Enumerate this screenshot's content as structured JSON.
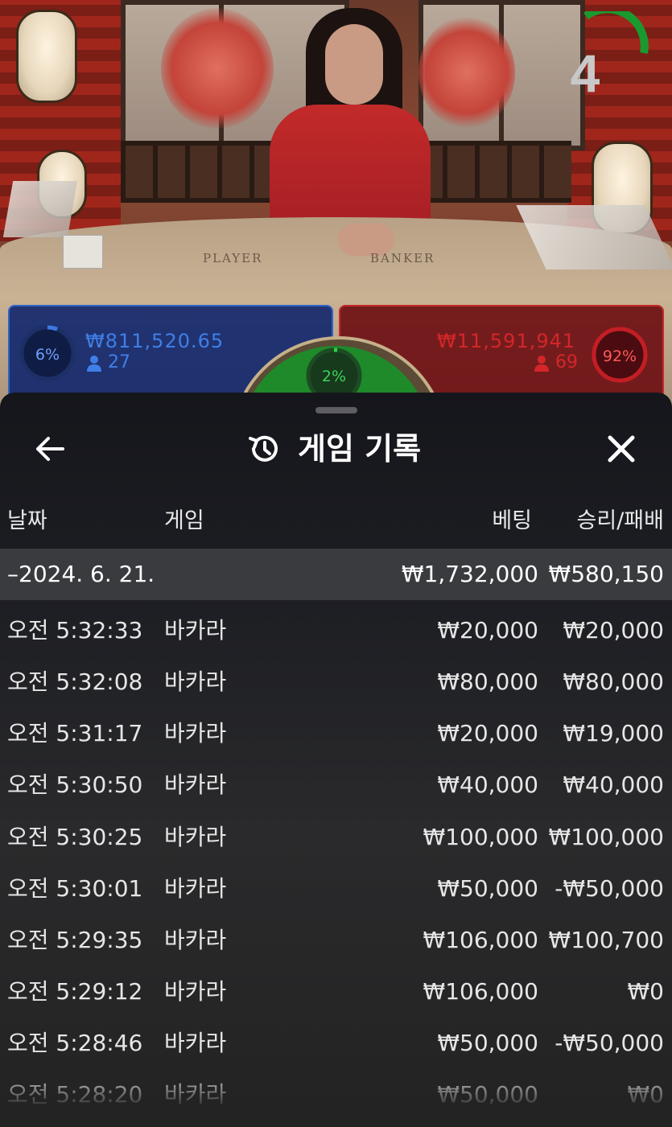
{
  "video": {
    "countdown": "4",
    "table_labels": {
      "player": "PLAYER",
      "banker": "BANKER"
    }
  },
  "betting": {
    "player": {
      "percent": "6%",
      "amount": "₩811,520.65",
      "count": "27",
      "color": "#2f62c8"
    },
    "tie": {
      "percent": "2%",
      "color": "#1f8a2a"
    },
    "banker": {
      "percent": "92%",
      "amount": "₩11,591,941",
      "count": "69",
      "color": "#c42a2a"
    }
  },
  "history": {
    "title": "게임 기록",
    "back_icon": "arrow-left-icon",
    "close_icon": "close-icon",
    "title_icon": "history-icon",
    "columns": {
      "date": "날짜",
      "game": "게임",
      "bet": "베팅",
      "win_loss": "승리/패배"
    },
    "group": {
      "date": "–2024. 6. 21.",
      "bet": "₩1,732,000",
      "win_loss": "₩580,150"
    },
    "rows": [
      {
        "time": "오전 5:32:33",
        "game": "바카라",
        "bet": "₩20,000",
        "win_loss": "₩20,000"
      },
      {
        "time": "오전 5:32:08",
        "game": "바카라",
        "bet": "₩80,000",
        "win_loss": "₩80,000"
      },
      {
        "time": "오전 5:31:17",
        "game": "바카라",
        "bet": "₩20,000",
        "win_loss": "₩19,000"
      },
      {
        "time": "오전 5:30:50",
        "game": "바카라",
        "bet": "₩40,000",
        "win_loss": "₩40,000"
      },
      {
        "time": "오전 5:30:25",
        "game": "바카라",
        "bet": "₩100,000",
        "win_loss": "₩100,000"
      },
      {
        "time": "오전 5:30:01",
        "game": "바카라",
        "bet": "₩50,000",
        "win_loss": "-₩50,000"
      },
      {
        "time": "오전 5:29:35",
        "game": "바카라",
        "bet": "₩106,000",
        "win_loss": "₩100,700"
      },
      {
        "time": "오전 5:29:12",
        "game": "바카라",
        "bet": "₩106,000",
        "win_loss": "₩0"
      },
      {
        "time": "오전 5:28:46",
        "game": "바카라",
        "bet": "₩50,000",
        "win_loss": "-₩50,000"
      },
      {
        "time": "오전 5:28:20",
        "game": "바카라",
        "bet": "₩50,000",
        "win_loss": "₩0"
      }
    ]
  }
}
